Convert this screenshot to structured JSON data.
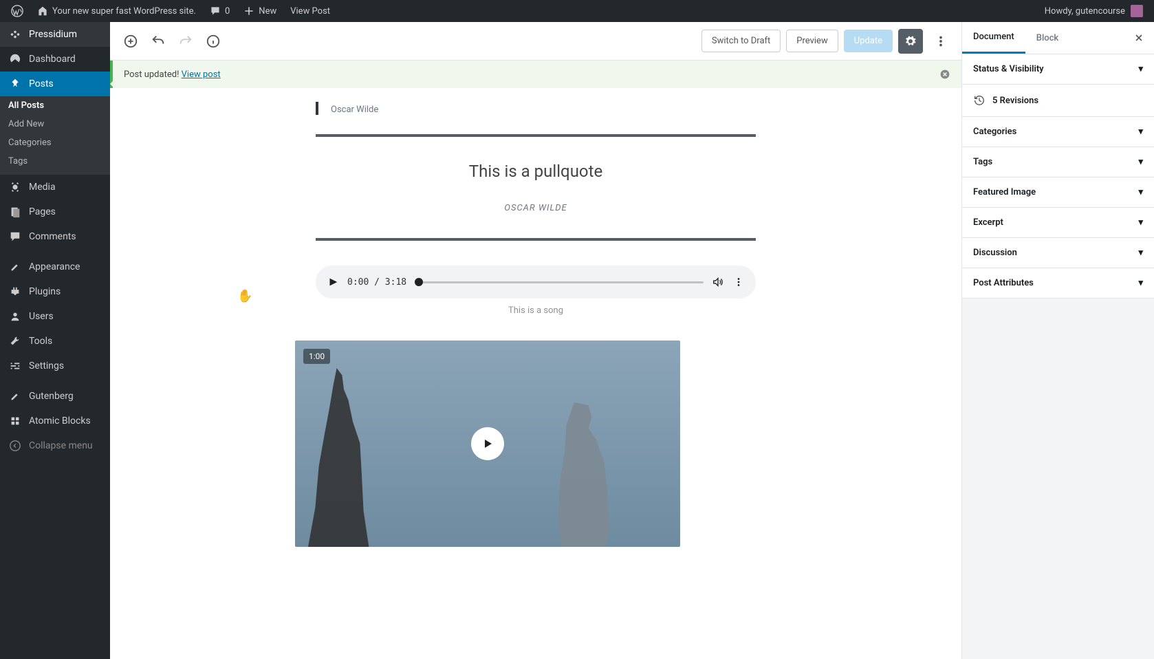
{
  "admin_bar": {
    "site_title": "Your new super fast WordPress site.",
    "comments_count": "0",
    "new_label": "New",
    "view_post": "View Post",
    "howdy": "Howdy, gutencourse"
  },
  "sidebar": {
    "host": "Pressidium",
    "items": [
      {
        "label": "Dashboard",
        "icon": "dashboard"
      },
      {
        "label": "Posts",
        "icon": "pin",
        "active": true,
        "sub": [
          {
            "label": "All Posts",
            "active": true
          },
          {
            "label": "Add New"
          },
          {
            "label": "Categories"
          },
          {
            "label": "Tags"
          }
        ]
      },
      {
        "label": "Media",
        "icon": "media"
      },
      {
        "label": "Pages",
        "icon": "pages"
      },
      {
        "label": "Comments",
        "icon": "comments"
      },
      {
        "label": "Appearance",
        "icon": "appearance"
      },
      {
        "label": "Plugins",
        "icon": "plugins"
      },
      {
        "label": "Users",
        "icon": "users"
      },
      {
        "label": "Tools",
        "icon": "tools"
      },
      {
        "label": "Settings",
        "icon": "settings"
      },
      {
        "label": "Gutenberg",
        "icon": "gutenberg"
      },
      {
        "label": "Atomic Blocks",
        "icon": "atomic"
      }
    ],
    "collapse": "Collapse menu"
  },
  "toolbar": {
    "switch_draft": "Switch to Draft",
    "preview": "Preview",
    "update": "Update"
  },
  "notice": {
    "text": "Post updated! ",
    "link": "View post"
  },
  "content": {
    "quote_cite": "Oscar Wilde",
    "pullquote_text": "This is a pullquote",
    "pullquote_cite": "OSCAR WILDE",
    "audio_time": "0:00 / 3:18",
    "audio_caption": "This is a song",
    "video_duration": "1:00"
  },
  "right_sidebar": {
    "tabs": {
      "document": "Document",
      "block": "Block"
    },
    "panels": [
      "Status & Visibility",
      "Categories",
      "Tags",
      "Featured Image",
      "Excerpt",
      "Discussion",
      "Post Attributes"
    ],
    "revisions": "5 Revisions"
  }
}
